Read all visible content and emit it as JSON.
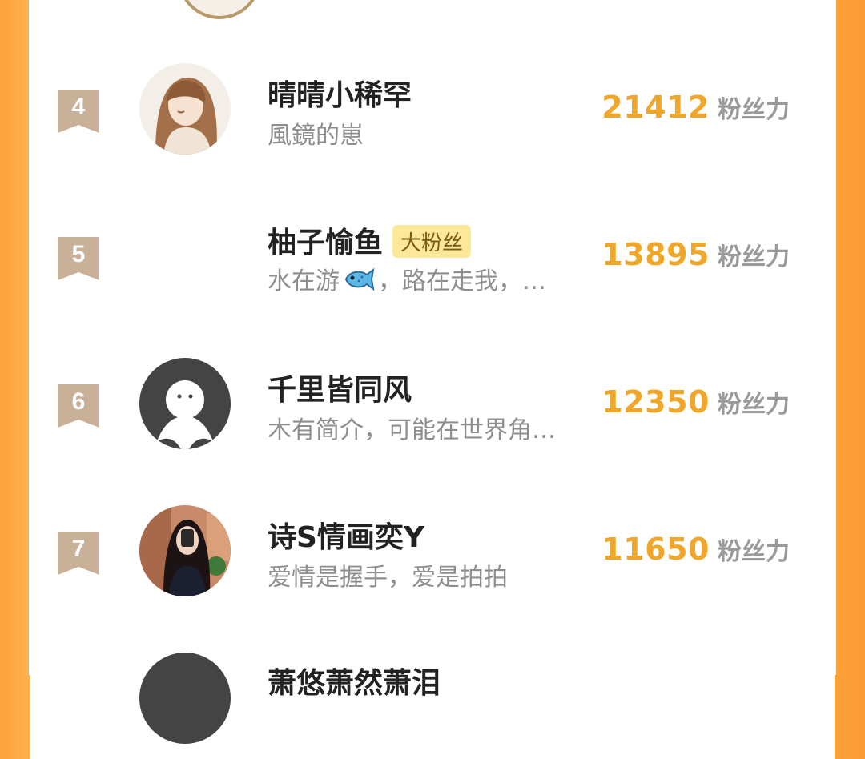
{
  "colors": {
    "accent": "#f0a629",
    "side_orange": "#fca23a",
    "fan_badge_bg": "#fde89a",
    "rank_badge": "#c9b098"
  },
  "ranking": {
    "rows": [
      {
        "rank": "4",
        "name": "晴晴小稀罕",
        "bio": "風鏡的崽",
        "score": "21412",
        "score_label": "粉丝力",
        "avatar": "anime-girl-avatar"
      },
      {
        "rank": "5",
        "name": "柚子愉鱼",
        "badge": "大粉丝",
        "bio_before": "水在游",
        "bio_after": "，路在走我，…",
        "score": "13895",
        "score_label": "粉丝力",
        "avatar": "blank-avatar"
      },
      {
        "rank": "6",
        "name": "千里皆同风",
        "bio": "木有简介，可能在世界角…",
        "score": "12350",
        "score_label": "粉丝力",
        "avatar": "default-ghost-avatar"
      },
      {
        "rank": "7",
        "name": "诗S情画奕Y",
        "bio": "爱情是握手，爱是拍拍",
        "score": "11650",
        "score_label": "粉丝力",
        "avatar": "selfie-photo-avatar"
      }
    ],
    "next_partial_name": "萧悠萧然萧泪"
  }
}
